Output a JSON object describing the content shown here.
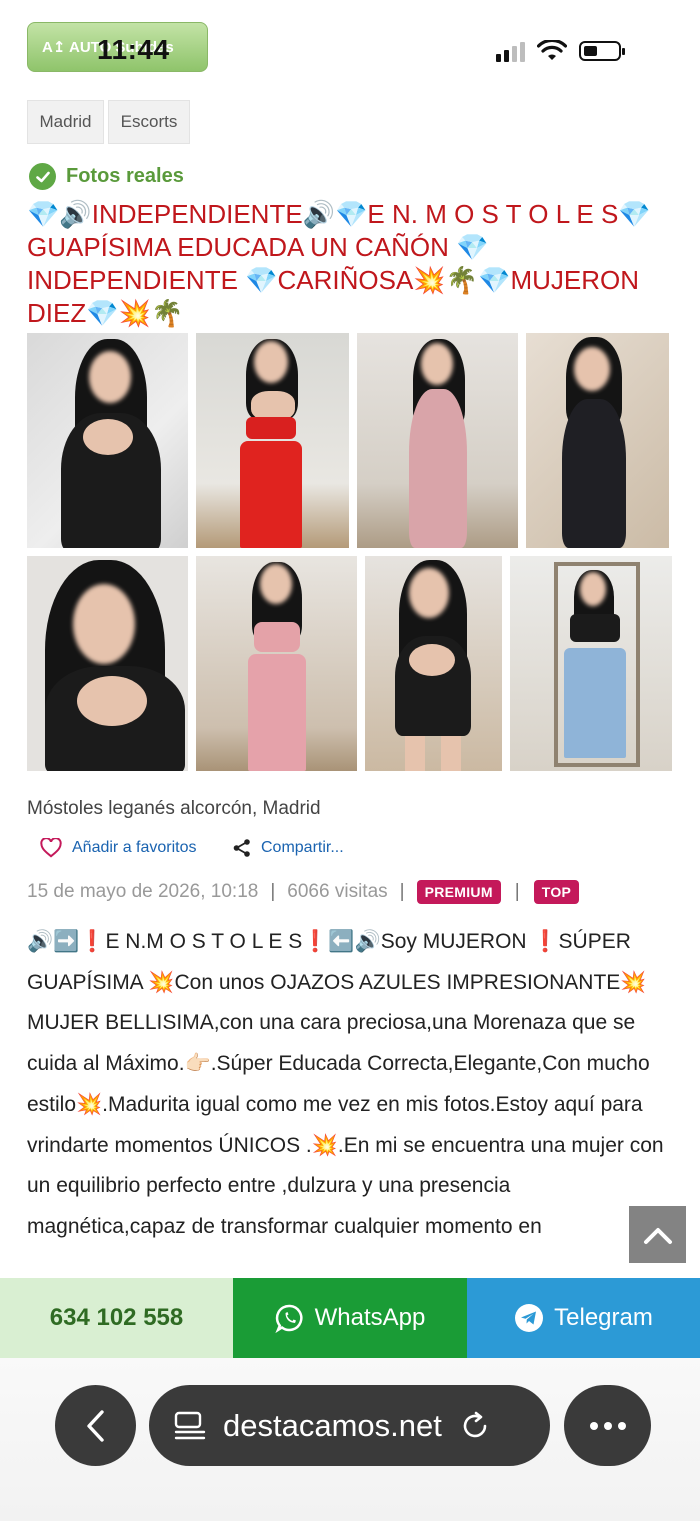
{
  "status_bar": {
    "auto_pill": "A↥ AUTO Subidas",
    "time": "11:44"
  },
  "breadcrumb": [
    "Madrid",
    "Escorts"
  ],
  "verified_label": "Fotos reales",
  "listing_title": "💎🔊INDEPENDIENTE🔊💎E N. M O S T O L E S💎 GUAPÍSIMA EDUCADA UN CAÑÓN 💎 INDEPENDIENTE 💎CARIÑOSA💥🌴💎MUJERON DIEZ💎💥🌴",
  "location": "Móstoles leganés alcorcón, Madrid",
  "actions": {
    "favorite": "Añadir a favoritos",
    "share": "Compartir..."
  },
  "meta": {
    "date": "15 de mayo de 2026, 10:18",
    "visits": "6066 visitas",
    "badge_premium": "PREMIUM",
    "badge_top": "TOP"
  },
  "description": "🔊➡️❗E N.M O S T O L E S❗⬅️🔊Soy MUJERON ❗SÚPER GUAPÍSIMA 💥Con unos OJAZOS AZULES IMPRESIONANTE💥MUJER BELLISIMA,con una cara preciosa,una Morenaza que se cuida al Máximo.👉🏻.Súper Educada Correcta,Elegante,Con mucho estilo💥.Madurita igual como me vez en mis fotos.Estoy aquí para vrindarte momentos ÚNICOS .💥.En mi se encuentra una mujer con un equilibrio perfecto entre ,dulzura y una presencia magnética,capaz de transformar cualquier momento en",
  "contact": {
    "phone": "634 102 558",
    "whatsapp": "WhatsApp",
    "telegram": "Telegram"
  },
  "browser": {
    "url": "destacamos.net"
  },
  "colors": {
    "title_red": "#c0171c",
    "whatsapp_green": "#1a9c36",
    "telegram_blue": "#2c9ad6",
    "badge_pink": "#c4195a"
  },
  "icons": [
    "signal-icon",
    "wifi-icon",
    "battery-icon",
    "check-circle-icon",
    "heart-icon",
    "share-icon",
    "chevron-up-icon",
    "whatsapp-icon",
    "telegram-icon",
    "chevron-left-icon",
    "reader-icon",
    "reload-icon",
    "more-icon"
  ]
}
